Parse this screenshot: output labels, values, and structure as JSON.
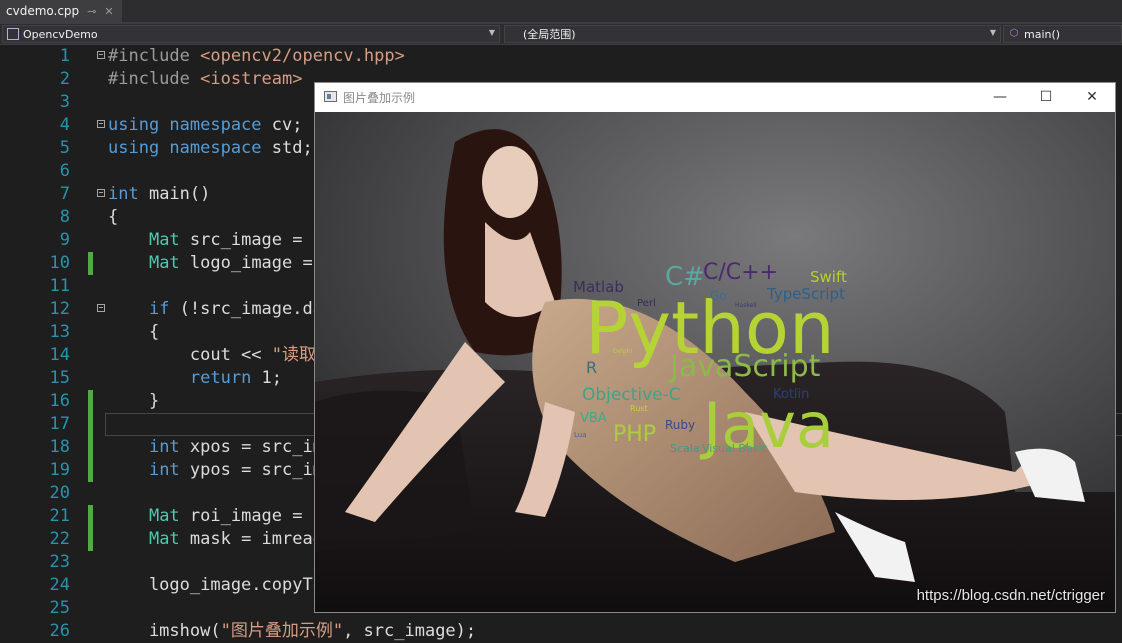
{
  "tab": {
    "title": "cvdemo.cpp",
    "pin": "⊸",
    "close": "✕"
  },
  "nav": {
    "project": "OpencvDemo",
    "scope": "(全局范围)",
    "member": "main()"
  },
  "lines": [
    {
      "n": "1",
      "parts": [
        [
          "pp",
          "#include "
        ],
        [
          "inc",
          "<opencv2/opencv.hpp>"
        ]
      ]
    },
    {
      "n": "2",
      "parts": [
        [
          "pp",
          "#include "
        ],
        [
          "inc",
          "<iostream>"
        ]
      ]
    },
    {
      "n": "3",
      "parts": []
    },
    {
      "n": "4",
      "parts": [
        [
          "kw",
          "using namespace"
        ],
        [
          "pl",
          " cv;"
        ]
      ]
    },
    {
      "n": "5",
      "parts": [
        [
          "kw",
          "using namespace"
        ],
        [
          "pl",
          " std;"
        ]
      ]
    },
    {
      "n": "6",
      "parts": []
    },
    {
      "n": "7",
      "parts": [
        [
          "kw",
          "int"
        ],
        [
          "pl",
          " main()"
        ]
      ]
    },
    {
      "n": "8",
      "parts": [
        [
          "pl",
          "{"
        ]
      ]
    },
    {
      "n": "9",
      "parts": [
        [
          "pl",
          "    "
        ],
        [
          "ty",
          "Mat"
        ],
        [
          "pl",
          " src_image = i"
        ]
      ]
    },
    {
      "n": "10",
      "parts": [
        [
          "pl",
          "    "
        ],
        [
          "ty",
          "Mat"
        ],
        [
          "pl",
          " logo_image = "
        ]
      ]
    },
    {
      "n": "11",
      "parts": []
    },
    {
      "n": "12",
      "parts": [
        [
          "pl",
          "    "
        ],
        [
          "kw",
          "if"
        ],
        [
          "pl",
          " (!src_image.da"
        ]
      ]
    },
    {
      "n": "13",
      "parts": [
        [
          "pl",
          "    {"
        ]
      ]
    },
    {
      "n": "14",
      "parts": [
        [
          "pl",
          "        cout << "
        ],
        [
          "str",
          "\"读取"
        ]
      ]
    },
    {
      "n": "15",
      "parts": [
        [
          "pl",
          "        "
        ],
        [
          "kw",
          "return"
        ],
        [
          "pl",
          " 1;"
        ]
      ]
    },
    {
      "n": "16",
      "parts": [
        [
          "pl",
          "    }"
        ]
      ]
    },
    {
      "n": "17",
      "parts": []
    },
    {
      "n": "18",
      "parts": [
        [
          "pl",
          "    "
        ],
        [
          "kw",
          "int"
        ],
        [
          "pl",
          " xpos = src_im"
        ]
      ]
    },
    {
      "n": "19",
      "parts": [
        [
          "pl",
          "    "
        ],
        [
          "kw",
          "int"
        ],
        [
          "pl",
          " ypos = src_im"
        ]
      ]
    },
    {
      "n": "20",
      "parts": []
    },
    {
      "n": "21",
      "parts": [
        [
          "pl",
          "    "
        ],
        [
          "ty",
          "Mat"
        ],
        [
          "pl",
          " roi_image = s"
        ]
      ]
    },
    {
      "n": "22",
      "parts": [
        [
          "pl",
          "    "
        ],
        [
          "ty",
          "Mat"
        ],
        [
          "pl",
          " mask = imread"
        ]
      ]
    },
    {
      "n": "23",
      "parts": []
    },
    {
      "n": "24",
      "parts": [
        [
          "pl",
          "    logo_image.copyTo"
        ]
      ]
    },
    {
      "n": "25",
      "parts": []
    },
    {
      "n": "26",
      "parts": [
        [
          "pl",
          "    imshow("
        ],
        [
          "str",
          "\"图片叠加示例\""
        ],
        [
          "pl",
          ", src_image);"
        ]
      ]
    }
  ],
  "window": {
    "title": "图片叠加示例",
    "minimize": "—",
    "maximize": "☐",
    "close": "✕"
  },
  "wordcloud": [
    {
      "text": "Python",
      "color": "#b5d334"
    },
    {
      "text": "Java",
      "color": "#a8cf3b"
    },
    {
      "text": "JavaScript",
      "color": "#8db94a"
    },
    {
      "text": "C/C++",
      "color": "#4a2a6a"
    },
    {
      "text": "C#",
      "color": "#5aa8a0"
    },
    {
      "text": "Matlab",
      "color": "#3a2d5e"
    },
    {
      "text": "Swift",
      "color": "#b8d02a"
    },
    {
      "text": "TypeScript",
      "color": "#2d5f8a"
    },
    {
      "text": "Objective-C",
      "color": "#3ea28a"
    },
    {
      "text": "Kotlin",
      "color": "#2d3f7a"
    },
    {
      "text": "PHP",
      "color": "#a9cf3c"
    },
    {
      "text": "Ruby",
      "color": "#2e4c8c"
    },
    {
      "text": "VBA",
      "color": "#40a88a"
    },
    {
      "text": "Scala",
      "color": "#3c9a86"
    },
    {
      "text": "Visual Basic",
      "color": "#4a9a82"
    },
    {
      "text": "Perl",
      "color": "#2e2e5a"
    },
    {
      "text": "Go",
      "color": "#3b6f8d"
    },
    {
      "text": "R",
      "color": "#346e8b"
    },
    {
      "text": "Lua",
      "color": "#3f5fa0"
    },
    {
      "text": "Rust",
      "color": "#c9d13c"
    },
    {
      "text": "Haskell",
      "color": "#3b3b6a"
    },
    {
      "text": "Delphi",
      "color": "#b5cf3b"
    }
  ],
  "watermark": "https://blog.csdn.net/ctrigger"
}
